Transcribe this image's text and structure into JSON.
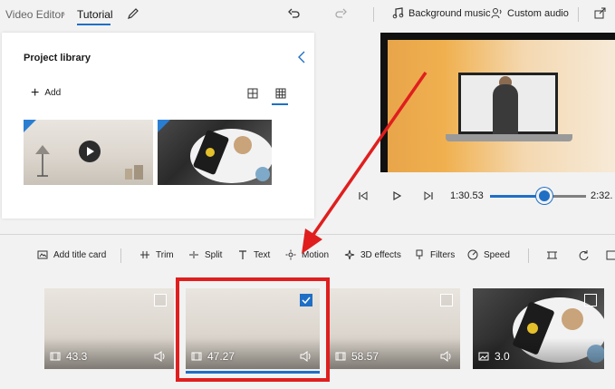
{
  "header": {
    "app": "Video Editor",
    "project": "Tutorial",
    "background_music": "Background music",
    "custom_audio": "Custom audio"
  },
  "library": {
    "title": "Project library",
    "add_label": "Add"
  },
  "player": {
    "current_time": "1:30.53",
    "end_time": "2:32.",
    "progress": 0.57
  },
  "storyboard_toolbar": {
    "add_title_card": "Add title card",
    "trim": "Trim",
    "split": "Split",
    "text": "Text",
    "motion": "Motion",
    "effects_3d": "3D effects",
    "filters": "Filters",
    "speed": "Speed"
  },
  "clips": [
    {
      "duration": "43.3",
      "selected": false,
      "type": "video"
    },
    {
      "duration": "47.27",
      "selected": true,
      "type": "video"
    },
    {
      "duration": "58.57",
      "selected": false,
      "type": "video"
    },
    {
      "duration": "3.0",
      "selected": false,
      "type": "image"
    }
  ],
  "colors": {
    "accent": "#1f6fc5",
    "annotation": "#e01e1e"
  }
}
